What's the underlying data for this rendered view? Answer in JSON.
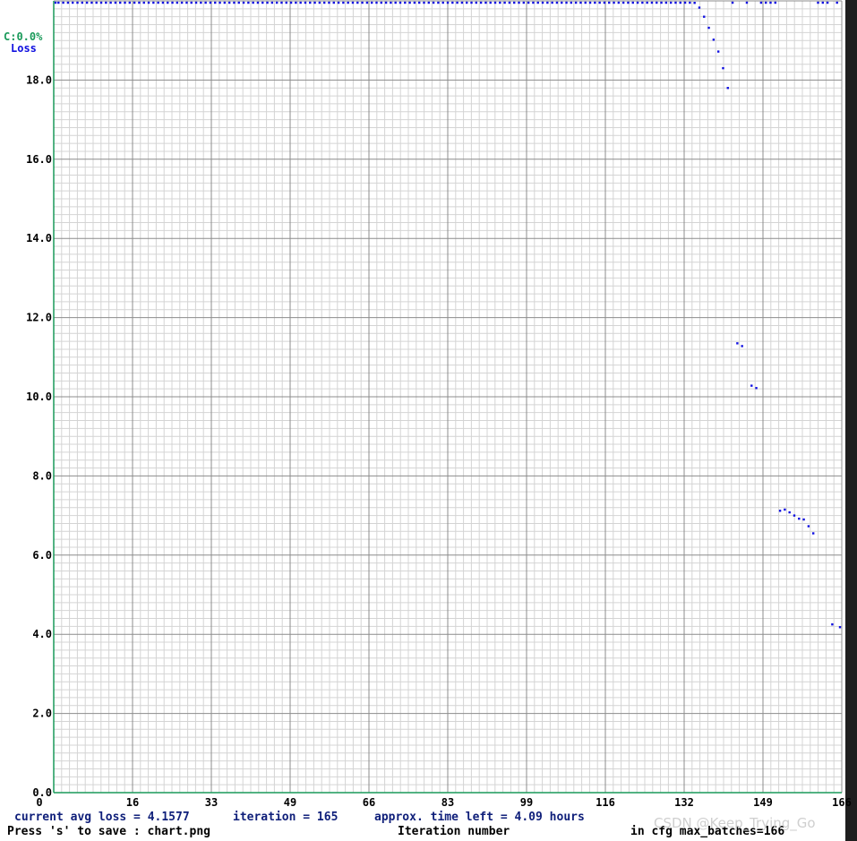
{
  "chart_data": {
    "type": "scatter",
    "title": "",
    "xlabel": "Iteration number",
    "ylabel": "",
    "xlim": [
      0,
      166
    ],
    "ylim": [
      0,
      20
    ],
    "x_ticks": [
      0,
      16,
      33,
      49,
      66,
      83,
      99,
      116,
      132,
      149,
      166
    ],
    "x_tick_labels": [
      "0",
      "16",
      "33",
      "49",
      "66",
      "83",
      "99",
      "116",
      "132",
      "149",
      "166"
    ],
    "y_ticks": [
      0,
      2,
      4,
      6,
      8,
      10,
      12,
      14,
      16,
      18
    ],
    "y_tick_labels": [
      "0.0",
      "2.0",
      "4.0",
      "6.0",
      "8.0",
      "10.0",
      "12.0",
      "14.0",
      "16.0",
      "18.0"
    ],
    "grid": true,
    "legend": {
      "position": "top-left",
      "items": [
        {
          "label": "C:0.0%",
          "color": "#1a9a5a"
        },
        {
          "label": "Loss",
          "color": "#1010e0"
        }
      ]
    },
    "series": [
      {
        "name": "Loss",
        "color": "#1010e0",
        "points": [
          [
            0,
            20.0
          ],
          [
            1,
            20.0
          ],
          [
            2,
            20.0
          ],
          [
            3,
            20.0
          ],
          [
            4,
            20.0
          ],
          [
            5,
            20.0
          ],
          [
            6,
            20.0
          ],
          [
            7,
            20.0
          ],
          [
            8,
            20.0
          ],
          [
            9,
            20.0
          ],
          [
            10,
            20.0
          ],
          [
            11,
            20.0
          ],
          [
            12,
            20.0
          ],
          [
            13,
            20.0
          ],
          [
            14,
            20.0
          ],
          [
            15,
            20.0
          ],
          [
            16,
            20.0
          ],
          [
            17,
            20.0
          ],
          [
            18,
            20.0
          ],
          [
            19,
            20.0
          ],
          [
            20,
            20.0
          ],
          [
            21,
            20.0
          ],
          [
            22,
            20.0
          ],
          [
            23,
            20.0
          ],
          [
            24,
            20.0
          ],
          [
            25,
            20.0
          ],
          [
            26,
            20.0
          ],
          [
            27,
            20.0
          ],
          [
            28,
            20.0
          ],
          [
            29,
            20.0
          ],
          [
            30,
            20.0
          ],
          [
            31,
            20.0
          ],
          [
            32,
            20.0
          ],
          [
            33,
            20.0
          ],
          [
            34,
            20.0
          ],
          [
            35,
            20.0
          ],
          [
            36,
            20.0
          ],
          [
            37,
            20.0
          ],
          [
            38,
            20.0
          ],
          [
            39,
            20.0
          ],
          [
            40,
            20.0
          ],
          [
            41,
            20.0
          ],
          [
            42,
            20.0
          ],
          [
            43,
            20.0
          ],
          [
            44,
            20.0
          ],
          [
            45,
            20.0
          ],
          [
            46,
            20.0
          ],
          [
            47,
            20.0
          ],
          [
            48,
            20.0
          ],
          [
            49,
            20.0
          ],
          [
            50,
            20.0
          ],
          [
            51,
            20.0
          ],
          [
            52,
            20.0
          ],
          [
            53,
            20.0
          ],
          [
            54,
            20.0
          ],
          [
            55,
            20.0
          ],
          [
            56,
            20.0
          ],
          [
            57,
            20.0
          ],
          [
            58,
            20.0
          ],
          [
            59,
            20.0
          ],
          [
            60,
            20.0
          ],
          [
            61,
            20.0
          ],
          [
            62,
            20.0
          ],
          [
            63,
            20.0
          ],
          [
            64,
            20.0
          ],
          [
            65,
            20.0
          ],
          [
            66,
            20.0
          ],
          [
            67,
            20.0
          ],
          [
            68,
            20.0
          ],
          [
            69,
            20.0
          ],
          [
            70,
            20.0
          ],
          [
            71,
            20.0
          ],
          [
            72,
            20.0
          ],
          [
            73,
            20.0
          ],
          [
            74,
            20.0
          ],
          [
            75,
            20.0
          ],
          [
            76,
            20.0
          ],
          [
            77,
            20.0
          ],
          [
            78,
            20.0
          ],
          [
            79,
            20.0
          ],
          [
            80,
            20.0
          ],
          [
            81,
            20.0
          ],
          [
            82,
            20.0
          ],
          [
            83,
            20.0
          ],
          [
            84,
            20.0
          ],
          [
            85,
            20.0
          ],
          [
            86,
            20.0
          ],
          [
            87,
            20.0
          ],
          [
            88,
            20.0
          ],
          [
            89,
            20.0
          ],
          [
            90,
            20.0
          ],
          [
            91,
            20.0
          ],
          [
            92,
            20.0
          ],
          [
            93,
            20.0
          ],
          [
            94,
            20.0
          ],
          [
            95,
            20.0
          ],
          [
            96,
            20.0
          ],
          [
            97,
            20.0
          ],
          [
            98,
            20.0
          ],
          [
            99,
            20.0
          ],
          [
            100,
            20.0
          ],
          [
            101,
            20.0
          ],
          [
            102,
            20.0
          ],
          [
            103,
            20.0
          ],
          [
            104,
            20.0
          ],
          [
            105,
            20.0
          ],
          [
            106,
            20.0
          ],
          [
            107,
            20.0
          ],
          [
            108,
            20.0
          ],
          [
            109,
            20.0
          ],
          [
            110,
            20.0
          ],
          [
            111,
            20.0
          ],
          [
            112,
            20.0
          ],
          [
            113,
            20.0
          ],
          [
            114,
            20.0
          ],
          [
            115,
            20.0
          ],
          [
            116,
            20.0
          ],
          [
            117,
            20.0
          ],
          [
            118,
            20.0
          ],
          [
            119,
            20.0
          ],
          [
            120,
            20.0
          ],
          [
            121,
            20.0
          ],
          [
            122,
            20.0
          ],
          [
            123,
            20.0
          ],
          [
            124,
            20.0
          ],
          [
            125,
            20.0
          ],
          [
            126,
            20.0
          ],
          [
            127,
            20.0
          ],
          [
            128,
            20.0
          ],
          [
            129,
            20.0
          ],
          [
            130,
            20.0
          ],
          [
            131,
            20.0
          ],
          [
            132,
            20.0
          ],
          [
            133,
            20.0
          ],
          [
            134,
            20.0
          ],
          [
            135,
            19.95
          ],
          [
            136,
            19.83
          ],
          [
            137,
            19.6
          ],
          [
            138,
            19.32
          ],
          [
            139,
            19.02
          ],
          [
            140,
            18.72
          ],
          [
            141,
            18.3
          ],
          [
            142,
            17.8
          ],
          [
            143,
            20.0
          ],
          [
            144,
            11.35
          ],
          [
            145,
            11.28
          ],
          [
            146,
            20.0
          ],
          [
            147,
            10.28
          ],
          [
            148,
            10.22
          ],
          [
            149,
            20.0
          ],
          [
            150,
            20.0
          ],
          [
            151,
            20.0
          ],
          [
            152,
            20.0
          ],
          [
            153,
            7.12
          ],
          [
            154,
            7.15
          ],
          [
            155,
            7.08
          ],
          [
            156,
            7.0
          ],
          [
            157,
            6.92
          ],
          [
            158,
            6.9
          ],
          [
            159,
            6.73
          ],
          [
            160,
            6.55
          ],
          [
            161,
            20.0
          ],
          [
            162,
            20.0
          ],
          [
            163,
            20.0
          ],
          [
            164,
            4.25
          ],
          [
            165,
            20.0
          ],
          [
            166,
            4.18
          ]
        ]
      }
    ]
  },
  "info": {
    "avg_loss": "current avg loss = 4.1577",
    "iteration": "iteration = 165",
    "time_left": "approx. time left = 4.09 hours",
    "save_hint": "Press 's' to save : chart.png",
    "max_batches": "in cfg max_batches=166"
  },
  "watermark": "CSDN @Keep_Trying_Go",
  "colors": {
    "background": "#ffffff",
    "minor_grid": "#d4d4d4",
    "major_grid": "#8c8c8c",
    "axis_line": "#1a9a5a",
    "info_text": "#0f1f7a",
    "footer_text": "#000000",
    "point": "#1010e0"
  }
}
